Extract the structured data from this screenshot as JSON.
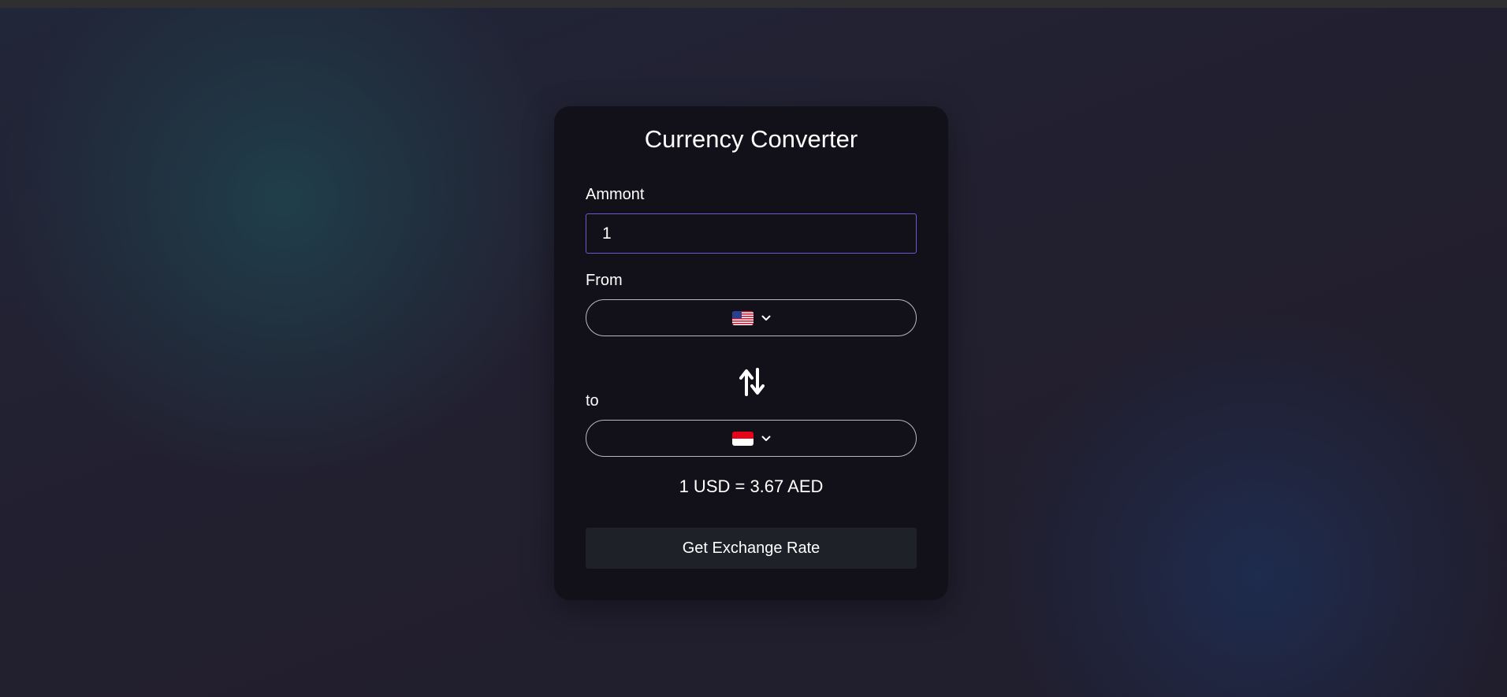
{
  "converter": {
    "title": "Currency Converter",
    "amount_label": "Ammont",
    "amount_value": "1",
    "from_label": "From",
    "from_flag": "us-flag-icon",
    "to_label": "to",
    "to_flag": "indonesia-flag-icon",
    "swap_icon": "swap-arrows-icon",
    "chevron_icon": "chevron-down-icon",
    "rate_text": "1 USD = 3.67 AED",
    "button_label": "Get Exchange Rate"
  },
  "colors": {
    "background": "#1f1e2b",
    "card": "#12111a",
    "input_border_focus": "#6c5ad1",
    "button": "#1f2128",
    "text": "#ffffff"
  }
}
